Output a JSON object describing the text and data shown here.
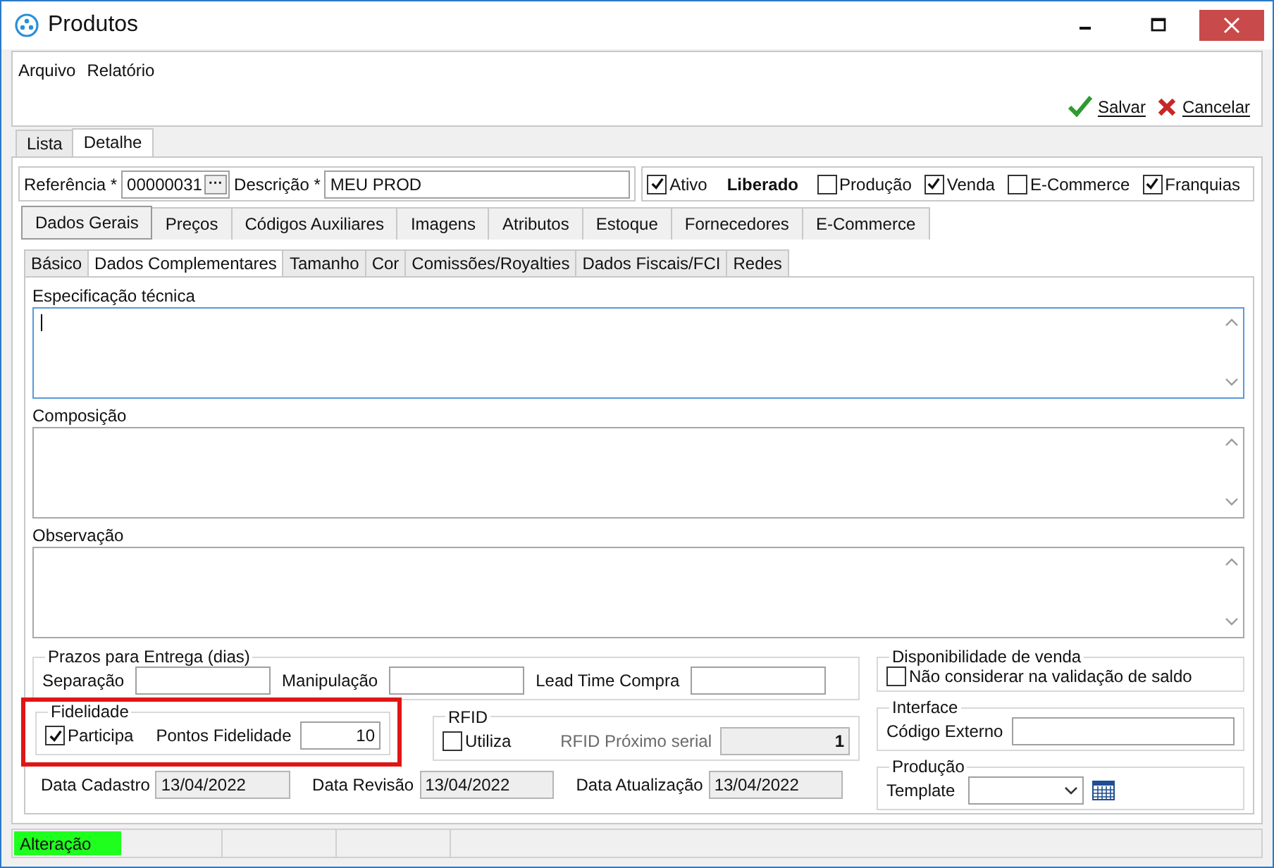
{
  "window": {
    "title": "Produtos"
  },
  "menu": [
    {
      "label": "Arquivo"
    },
    {
      "label": "Relatório"
    }
  ],
  "actions": [
    {
      "kind": "save",
      "label": "Salvar"
    },
    {
      "kind": "cancel",
      "label": "Cancelar"
    }
  ],
  "main_tabs": [
    {
      "label": "Lista",
      "selected": false
    },
    {
      "label": "Detalhe",
      "selected": true
    }
  ],
  "header": {
    "referencia": {
      "label": "Referência *",
      "value": "00000031",
      "button": "···"
    },
    "descricao": {
      "label": "Descrição *",
      "value": "MEU PROD"
    },
    "flags": [
      {
        "label": "Ativo",
        "checked": true
      },
      {
        "label": "Produção",
        "checked": false
      },
      {
        "label": "Venda",
        "checked": true
      },
      {
        "label": "E-Commerce",
        "checked": false
      },
      {
        "label": "Franquias",
        "checked": true
      }
    ],
    "status": "Liberado"
  },
  "section_tabs": [
    {
      "label": "Dados Gerais",
      "selected": true
    },
    {
      "label": "Preços",
      "selected": false
    },
    {
      "label": "Códigos Auxiliares",
      "selected": false
    },
    {
      "label": "Imagens",
      "selected": false
    },
    {
      "label": "Atributos",
      "selected": false
    },
    {
      "label": "Estoque",
      "selected": false
    },
    {
      "label": "Fornecedores",
      "selected": false
    },
    {
      "label": "E-Commerce",
      "selected": false
    }
  ],
  "sub_tabs": [
    {
      "label": "Básico",
      "selected": false
    },
    {
      "label": "Dados Complementares",
      "selected": true
    },
    {
      "label": "Tamanho",
      "selected": false
    },
    {
      "label": "Cor",
      "selected": false
    },
    {
      "label": "Comissões/Royalties",
      "selected": false
    },
    {
      "label": "Dados Fiscais/FCI",
      "selected": false
    },
    {
      "label": "Redes",
      "selected": false
    }
  ],
  "text_areas": [
    {
      "label": "Especificação técnica",
      "focused": true
    },
    {
      "label": "Composição",
      "focused": false
    },
    {
      "label": "Observação",
      "focused": false
    }
  ],
  "prazos": {
    "title": "Prazos para Entrega (dias)",
    "fields": [
      {
        "label": "Separação"
      },
      {
        "label": "Manipulação"
      },
      {
        "label": "Lead Time Compra"
      }
    ]
  },
  "fidelidade": {
    "title": "Fidelidade",
    "highlighted": true,
    "participa": {
      "label": "Participa",
      "checked": true
    },
    "pontos": {
      "label": "Pontos Fidelidade",
      "value": "10"
    }
  },
  "rfid": {
    "title": "RFID",
    "utiliza": {
      "label": "Utiliza",
      "checked": false
    },
    "serial": {
      "label": "RFID Próximo serial",
      "value": "1"
    }
  },
  "dates": [
    {
      "label": "Data Cadastro",
      "value": "13/04/2022"
    },
    {
      "label": "Data Revisão",
      "value": "13/04/2022"
    },
    {
      "label": "Data Atualização",
      "value": "13/04/2022"
    }
  ],
  "disponibilidade": {
    "title": "Disponibilidade de venda",
    "option": {
      "label": "Não considerar na validação de saldo",
      "checked": false
    }
  },
  "interface": {
    "title": "Interface",
    "field": {
      "label": "Código Externo"
    }
  },
  "producao": {
    "title": "Produção",
    "field": {
      "label": "Template"
    }
  },
  "status_bar": {
    "mode": "Alteração"
  }
}
